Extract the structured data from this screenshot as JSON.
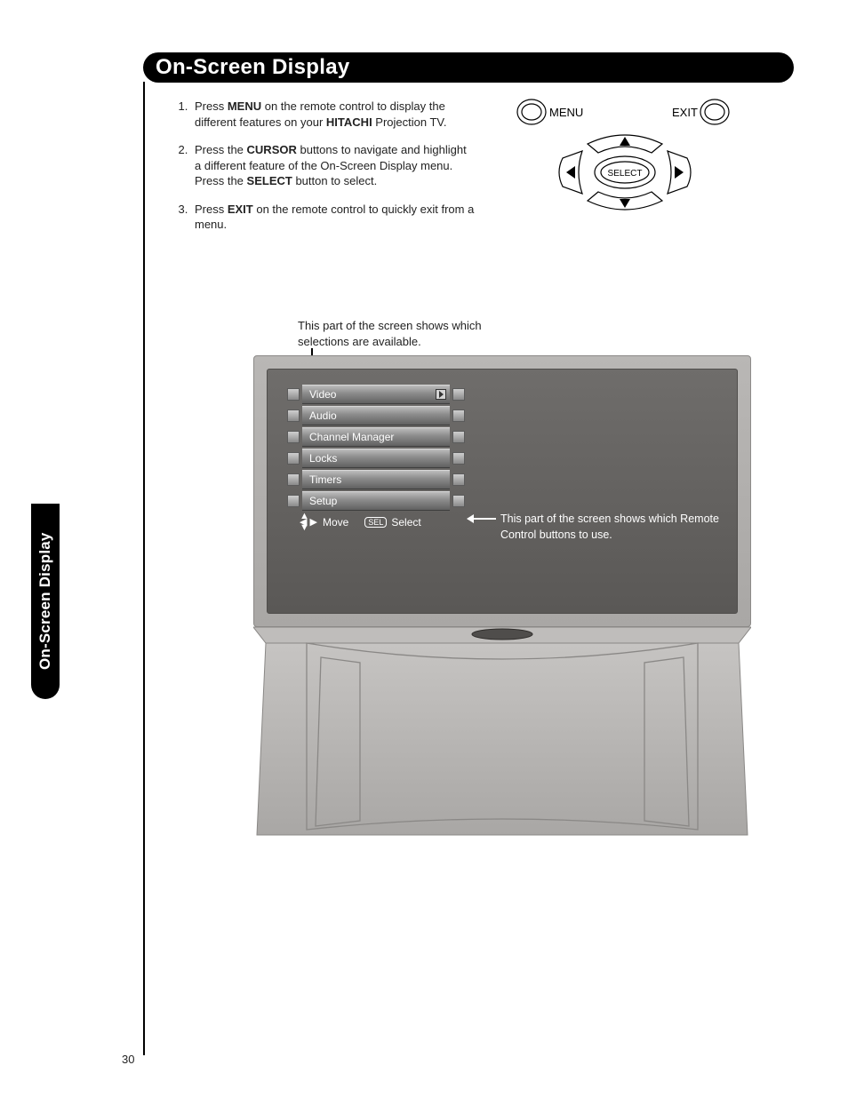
{
  "page_number": "30",
  "header": {
    "title": "On-Screen Display"
  },
  "side_tab": {
    "label": "On-Screen Display"
  },
  "instructions": {
    "items": [
      {
        "pre": "Press ",
        "bold1": "MENU",
        "mid": " on the remote control to display the different features on your ",
        "bold2": "HITACHI",
        "post": " Projection TV."
      },
      {
        "pre": "Press the ",
        "bold1": "CURSOR",
        "mid": " buttons to navigate and highlight a different feature of the On-Screen Display menu. Press the ",
        "bold2": "SELECT",
        "post": " button to select."
      },
      {
        "pre": "Press ",
        "bold1": "EXIT",
        "mid": " on the remote control to quickly exit from a menu.",
        "bold2": "",
        "post": ""
      }
    ]
  },
  "remote": {
    "menu_label": "MENU",
    "exit_label": "EXIT",
    "select_label": "SELECT"
  },
  "callouts": {
    "top": "This part of the screen shows which selections are available.",
    "right": "This part of the screen shows which Remote Control buttons to use."
  },
  "osd": {
    "items": [
      {
        "label": "Video",
        "has_arrow": true
      },
      {
        "label": "Audio"
      },
      {
        "label": "Channel Manager"
      },
      {
        "label": "Locks"
      },
      {
        "label": "Timers"
      },
      {
        "label": "Setup"
      }
    ],
    "help": {
      "move": "Move",
      "sel_box": "SEL",
      "select": "Select"
    }
  }
}
